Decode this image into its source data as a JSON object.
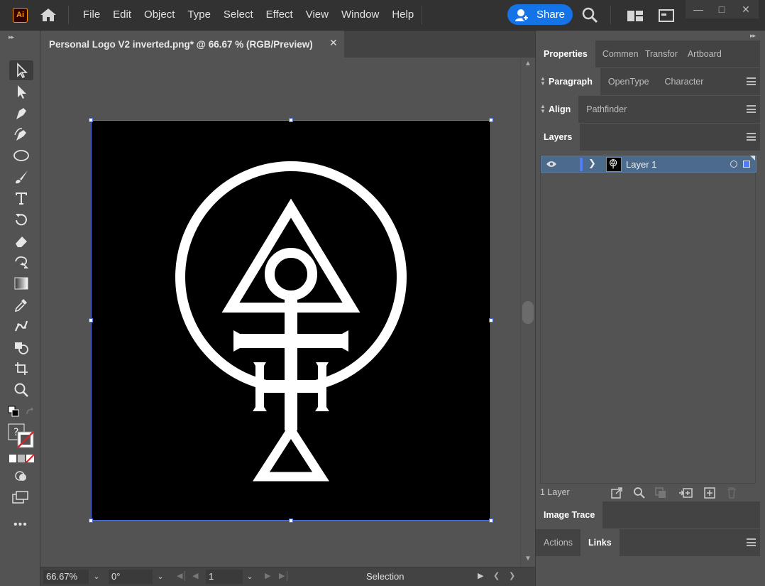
{
  "app": {
    "logo_text": "Ai",
    "brand_color": "#ff9a00",
    "accent_color": "#1473e6"
  },
  "menu": {
    "items": [
      "File",
      "Edit",
      "Object",
      "Type",
      "Select",
      "Effect",
      "View",
      "Window",
      "Help"
    ]
  },
  "share": {
    "label": "Share"
  },
  "window_controls": {
    "minimize": "—",
    "maximize": "□",
    "close": "✕"
  },
  "document": {
    "tab_title": "Personal Logo V2 inverted.png* @ 66.67 % (RGB/Preview)",
    "close_glyph": "✕"
  },
  "status": {
    "zoom": "66.67%",
    "rotation": "0°",
    "artboard_number": "1",
    "mode": "Selection"
  },
  "panels": {
    "group1_tabs": [
      "Properties",
      "Commen",
      "Transfor",
      "Artboard"
    ],
    "group2_tabs": [
      "Paragraph",
      "OpenType",
      "Character"
    ],
    "group3_tabs": [
      "Align",
      "Pathfinder"
    ],
    "group4_tabs": [
      "Layers"
    ],
    "group5_tabs": [
      "Image Trace"
    ],
    "group6_tabs": [
      "Actions",
      "Links"
    ]
  },
  "layers": {
    "items": [
      {
        "name": "Layer 1",
        "color": "#4f7df9"
      }
    ],
    "count_label": "1 Layer"
  }
}
